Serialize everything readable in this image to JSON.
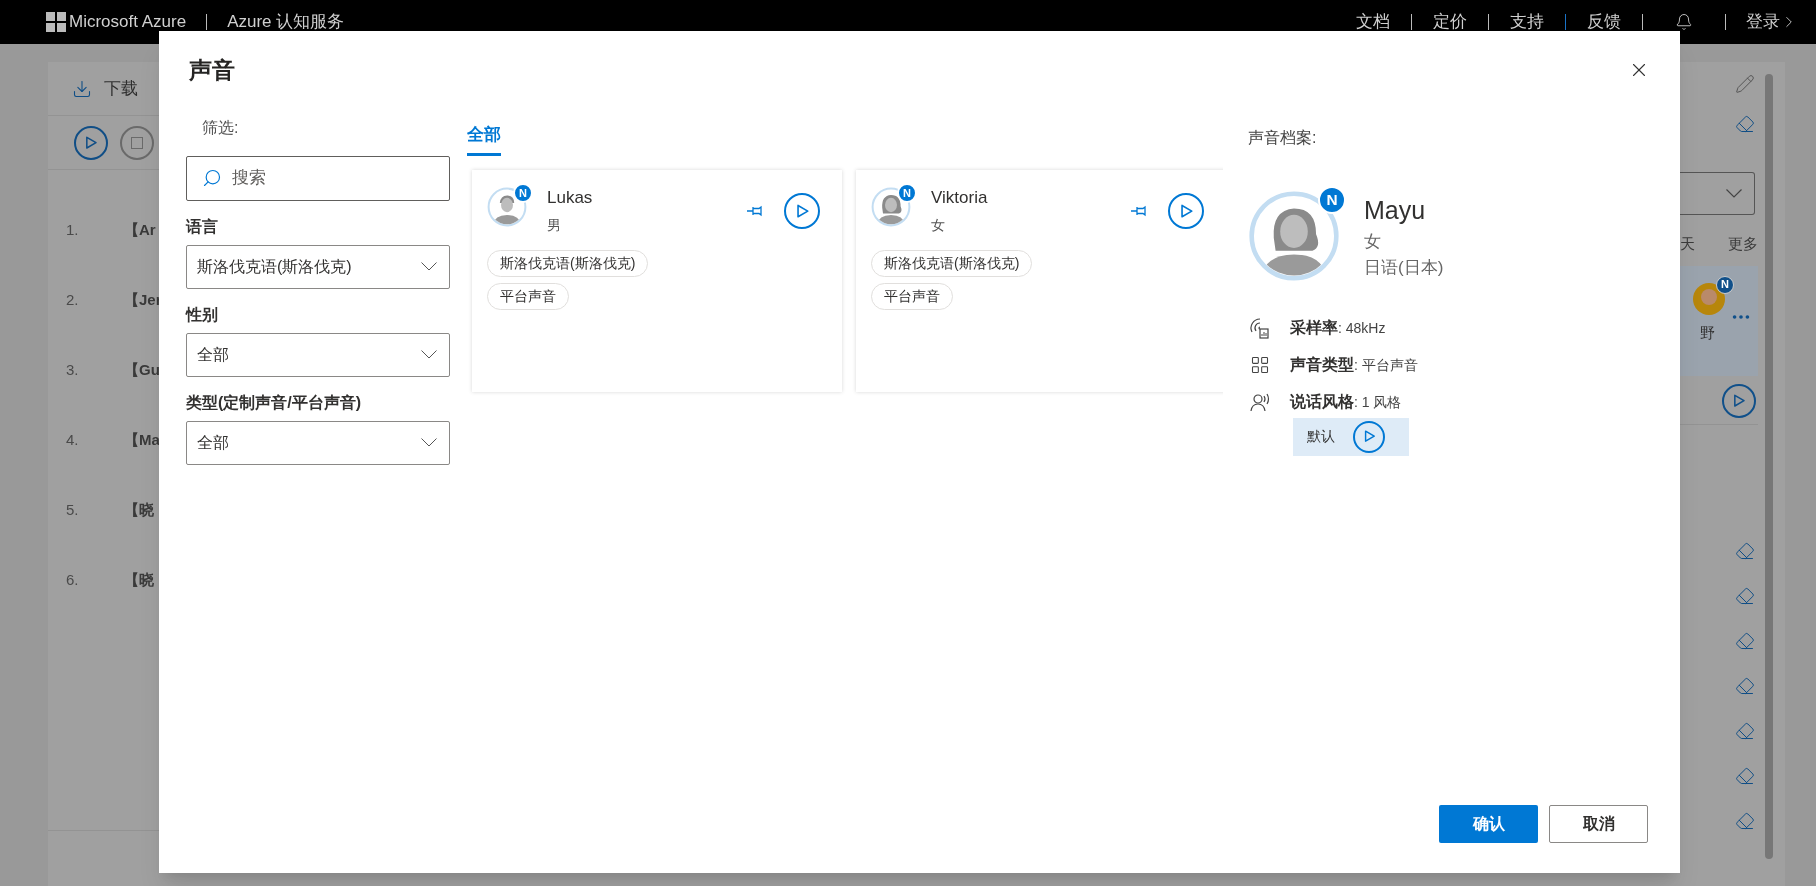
{
  "top_bar": {
    "brand": "Microsoft Azure",
    "service": "Azure 认知服务",
    "links": [
      {
        "label": "文档"
      },
      {
        "label": "定价"
      },
      {
        "label": "支持"
      },
      {
        "label": "反馈"
      }
    ],
    "login": "登录"
  },
  "background": {
    "download": "下载",
    "rows": [
      {
        "number": "1.",
        "text": "【Ar"
      },
      {
        "number": "2.",
        "text": "【Jer"
      },
      {
        "number": "3.",
        "text": "【Gu"
      },
      {
        "number": "4.",
        "text": "【Ma"
      },
      {
        "number": "5.",
        "text": "【晓"
      },
      {
        "number": "6.",
        "text": "【晓"
      }
    ],
    "right_tabs": [
      {
        "label": "天"
      },
      {
        "label": "更多"
      }
    ],
    "right_card": {
      "badge": "N",
      "name": "野"
    }
  },
  "dialog": {
    "title": "声音",
    "filters": {
      "heading": "筛选:",
      "search": {
        "placeholder": "搜索"
      },
      "selects": [
        {
          "label": "语言",
          "value": "斯洛伐克语(斯洛伐克)"
        },
        {
          "label": "性别",
          "value": "全部"
        },
        {
          "label": "类型(定制声音/平台声音)",
          "value": "全部"
        }
      ]
    },
    "tabs": [
      {
        "label": "全部",
        "selected": true
      }
    ],
    "voices": [
      {
        "name": "Lukas",
        "gender": "男",
        "badge": "N",
        "kind": "male",
        "tags": [
          "斯洛伐克语(斯洛伐克)",
          "平台声音"
        ]
      },
      {
        "name": "Viktoria",
        "gender": "女",
        "badge": "N",
        "kind": "female",
        "tags": [
          "斯洛伐克语(斯洛伐克)",
          "平台声音"
        ]
      }
    ],
    "profile": {
      "heading": "声音档案:",
      "badge": "N",
      "name": "Mayu",
      "gender": "女",
      "locale": "日语(日本)",
      "stats": [
        {
          "kind": "sample_rate",
          "text": "**采样率**: 48kHz"
        },
        {
          "kind": "voice_type",
          "text": "**声音类型**: 平台声音"
        },
        {
          "kind": "speaking_style",
          "text": "**说话风格**: 1 风格"
        }
      ],
      "styles": [
        {
          "label": "默认"
        }
      ]
    },
    "buttons": [
      {
        "label": "确认",
        "kind": "primary"
      },
      {
        "label": "取消",
        "kind": "secondary"
      }
    ]
  }
}
